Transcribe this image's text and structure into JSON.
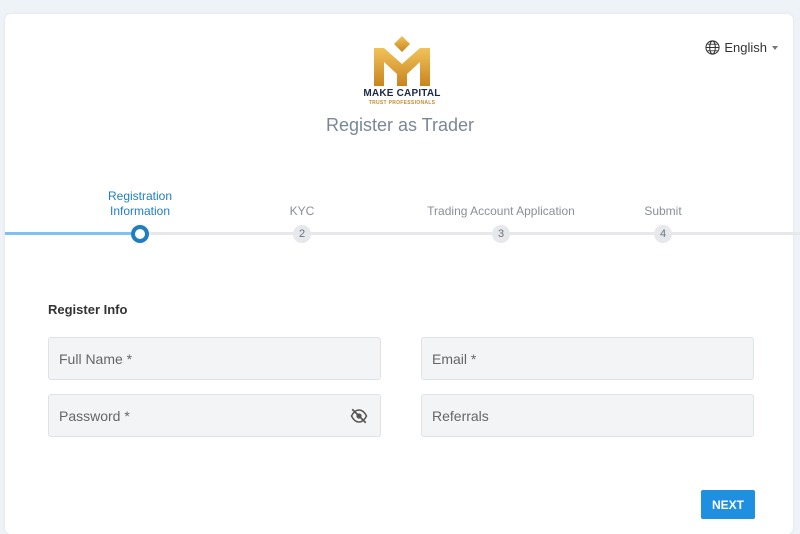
{
  "brand": {
    "name": "MAKE CAPITAL",
    "tagline": "TRUST PROFESSIONALS",
    "colors": {
      "gold": "#d69a2d",
      "navy": "#1b2a44"
    }
  },
  "language": {
    "icon": "globe-icon",
    "label": "English"
  },
  "page": {
    "title": "Register as Trader"
  },
  "steps": [
    {
      "label": "Registration Information",
      "number": "",
      "active": true
    },
    {
      "label": "KYC",
      "number": "2",
      "active": false
    },
    {
      "label": "Trading Account Application",
      "number": "3",
      "active": false
    },
    {
      "label": "Submit",
      "number": "4",
      "active": false
    }
  ],
  "form": {
    "section_title": "Register Info",
    "full_name": {
      "placeholder": "Full Name *",
      "value": ""
    },
    "email": {
      "placeholder": "Email *",
      "value": ""
    },
    "password": {
      "placeholder": "Password *",
      "value": "",
      "icon": "eye-slash-icon"
    },
    "referrals": {
      "placeholder": "Referrals",
      "value": ""
    }
  },
  "actions": {
    "next_label": "NEXT"
  },
  "colors": {
    "primary": "#1f8fe1",
    "active_step": "#1f7ec1",
    "field_bg": "#f3f4f6"
  }
}
